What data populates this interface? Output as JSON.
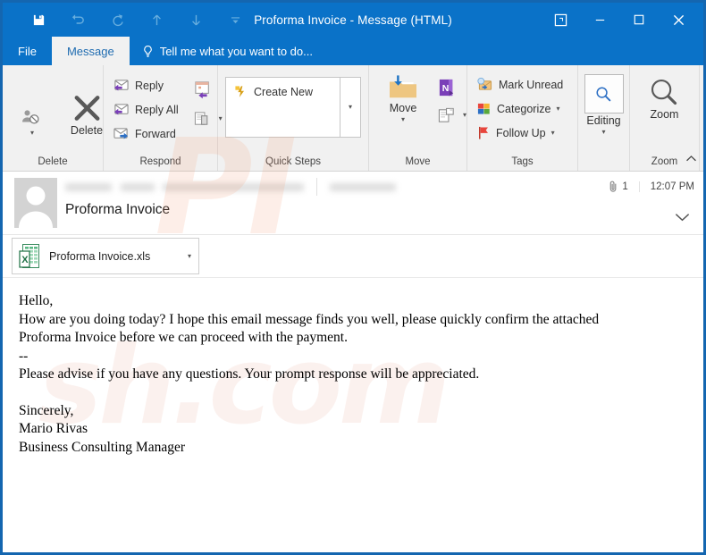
{
  "window": {
    "title": "Proforma Invoice  -  Message (HTML)",
    "border_color": "#1466b0",
    "titlebar_color": "#0a72c8"
  },
  "quick_access": {
    "items": [
      {
        "name": "save",
        "icon": "save-icon",
        "enabled": true
      },
      {
        "name": "undo",
        "icon": "undo-icon",
        "enabled": false
      },
      {
        "name": "redo",
        "icon": "redo-icon",
        "enabled": false
      },
      {
        "name": "previous-item",
        "icon": "arrow-up-icon",
        "enabled": false
      },
      {
        "name": "next-item",
        "icon": "arrow-down-icon",
        "enabled": false
      },
      {
        "name": "customize-quick-access-toolbar",
        "icon": "chevron-down-icon",
        "enabled": false
      }
    ]
  },
  "window_controls": [
    {
      "name": "touch-mode",
      "icon": "popout-icon"
    },
    {
      "name": "minimize",
      "icon": "minimize-icon"
    },
    {
      "name": "maximize",
      "icon": "maximize-icon"
    },
    {
      "name": "close",
      "icon": "close-icon"
    }
  ],
  "tabs": {
    "file_label": "File",
    "message_label": "Message",
    "tellme_placeholder": "Tell me what you want to do..."
  },
  "ribbon": {
    "groups": [
      {
        "label": "Delete",
        "items": [
          {
            "label": "Ignore",
            "icon": "ignore-person-icon"
          },
          {
            "label": "Delete",
            "icon": "delete-x-icon"
          }
        ]
      },
      {
        "label": "Respond",
        "items": [
          {
            "label": "Reply",
            "icon": "reply-icon"
          },
          {
            "label": "Reply All",
            "icon": "reply-all-icon"
          },
          {
            "label": "Forward",
            "icon": "forward-icon"
          },
          {
            "label": "Meeting",
            "icon": "meeting-calendar-icon"
          },
          {
            "label": "More",
            "icon": "more-respond-icon"
          }
        ]
      },
      {
        "label": "Quick Steps",
        "items": [
          {
            "label": "Create New",
            "icon": "lightning-bolt-icon"
          }
        ]
      },
      {
        "label": "Move",
        "items": [
          {
            "label": "Move",
            "icon": "move-folder-icon"
          },
          {
            "label": "OneNote",
            "icon": "onenote-icon"
          },
          {
            "label": "Rules",
            "icon": "rules-icon"
          }
        ]
      },
      {
        "label": "Tags",
        "items": [
          {
            "label": "Mark Unread",
            "icon": "mark-unread-icon"
          },
          {
            "label": "Categorize",
            "icon": "categorize-icon"
          },
          {
            "label": "Follow Up",
            "icon": "follow-up-flag-icon"
          }
        ]
      },
      {
        "label": "Editing",
        "items": [
          {
            "label": "Editing",
            "icon": "editing-magnifier-icon"
          }
        ]
      },
      {
        "label": "Zoom",
        "items": [
          {
            "label": "Zoom",
            "icon": "zoom-magnifier-icon"
          }
        ]
      }
    ]
  },
  "message": {
    "subject": "Proforma Invoice",
    "sender_redacted": true,
    "recipient_redacted": true,
    "attachment_count": "1",
    "time": "12:07 PM",
    "attachment": {
      "filename": "Proforma Invoice.xls",
      "type": "excel"
    },
    "body_lines": [
      "Hello,",
      "How are you doing today? I hope this email message finds you well, please quickly confirm the attached",
      "Proforma Invoice before we can proceed with the payment.",
      "--",
      "Please advise if you have any questions. Your prompt response will be appreciated."
    ],
    "signature_lines": [
      "Sincerely,",
      "Mario Rivas",
      "Business Consulting Manager"
    ]
  },
  "watermark": {
    "line1": "PI",
    "line2": "sh.com"
  }
}
